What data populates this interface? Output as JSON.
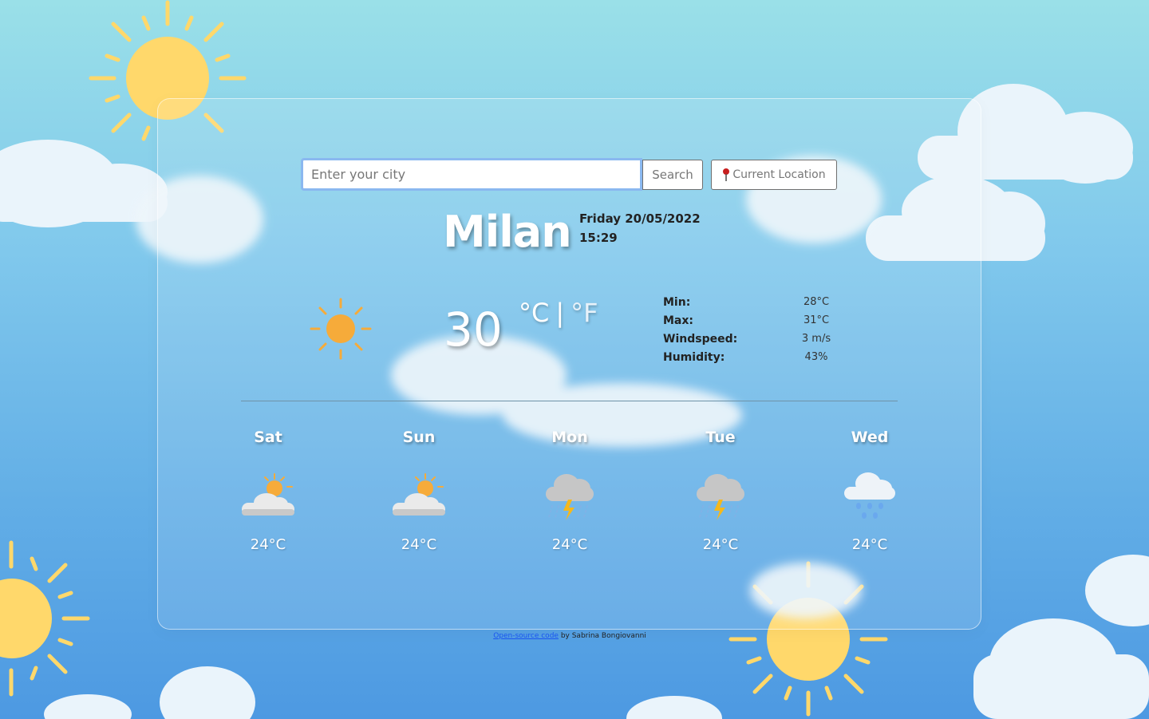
{
  "search": {
    "placeholder": "Enter your city",
    "button_label": "Search",
    "location_label": "Current Location"
  },
  "current": {
    "city": "Milan",
    "date": "Friday 20/05/2022",
    "time": "15:29",
    "temperature": "30",
    "unit_c": "°C",
    "unit_separator": "|",
    "unit_f": "°F",
    "icon": "sun-icon",
    "details": [
      {
        "label": "Min:",
        "value": "28°C"
      },
      {
        "label": "Max:",
        "value": "31°C"
      },
      {
        "label": "Windspeed:",
        "value": "3 m/s"
      },
      {
        "label": "Humidity:",
        "value": "43%"
      }
    ]
  },
  "forecast": [
    {
      "day": "Sat",
      "temp": "24°C",
      "icon": "partly-cloudy-icon"
    },
    {
      "day": "Sun",
      "temp": "24°C",
      "icon": "partly-cloudy-icon"
    },
    {
      "day": "Mon",
      "temp": "24°C",
      "icon": "thunderstorm-icon"
    },
    {
      "day": "Tue",
      "temp": "24°C",
      "icon": "thunderstorm-icon"
    },
    {
      "day": "Wed",
      "temp": "24°C",
      "icon": "rain-icon"
    }
  ],
  "footer": {
    "link_text": "Open-source code",
    "suffix": " by Sabrina Bongiovanni"
  },
  "colors": {
    "sun": "#f6ab3a",
    "background_sun": "#ffd86b",
    "cloud": "#eaf4fb",
    "link": "#1a55f0"
  }
}
